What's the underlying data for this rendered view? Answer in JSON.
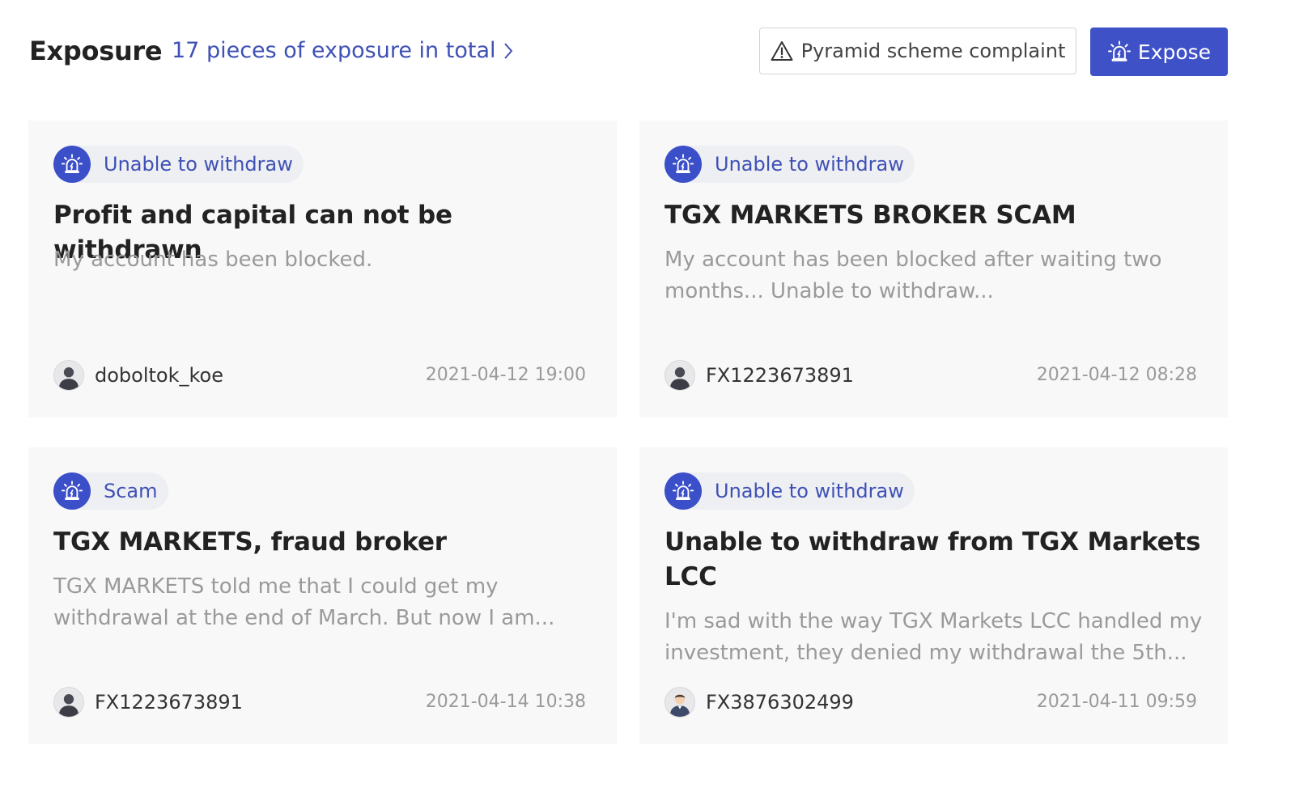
{
  "header": {
    "title": "Exposure",
    "total_link": "17 pieces of exposure in total",
    "complaint_button": "Pyramid scheme complaint",
    "expose_button": "Expose"
  },
  "icons": {
    "chevron": "chevron-right-icon",
    "complaint": "warning-triangle-icon",
    "expose": "alarm-siren-icon",
    "tag": "alarm-siren-icon",
    "avatar": "user-avatar-icon"
  },
  "colors": {
    "accent": "#3f51c7",
    "link": "#3f51b5",
    "card_bg": "#f8f8f9",
    "muted_text": "#9a9a9a"
  },
  "cards": [
    {
      "tag": "Unable to withdraw",
      "title": "Profit and capital can not be withdrawn",
      "description": "My account has been blocked.",
      "user": "doboltok_koe",
      "date": "2021-04-12 19:00"
    },
    {
      "tag": "Unable to withdraw",
      "title": "TGX MARKETS BROKER SCAM",
      "description": "My account has been blocked after waiting two months... Unable to withdraw...",
      "user": "FX1223673891",
      "date": "2021-04-12 08:28"
    },
    {
      "tag": "Scam",
      "title": "TGX MARKETS, fraud broker",
      "description": "TGX MARKETS told me that I could get my withdrawal at the end of March. But now I am...",
      "user": "FX1223673891",
      "date": "2021-04-14 10:38"
    },
    {
      "tag": "Unable to withdraw",
      "title": "Unable to withdraw from TGX Markets LCC",
      "description": "I'm sad with the way TGX Markets LCC handled my investment, they denied my withdrawal the 5th...",
      "user": "FX3876302499",
      "date": "2021-04-11 09:59"
    }
  ]
}
